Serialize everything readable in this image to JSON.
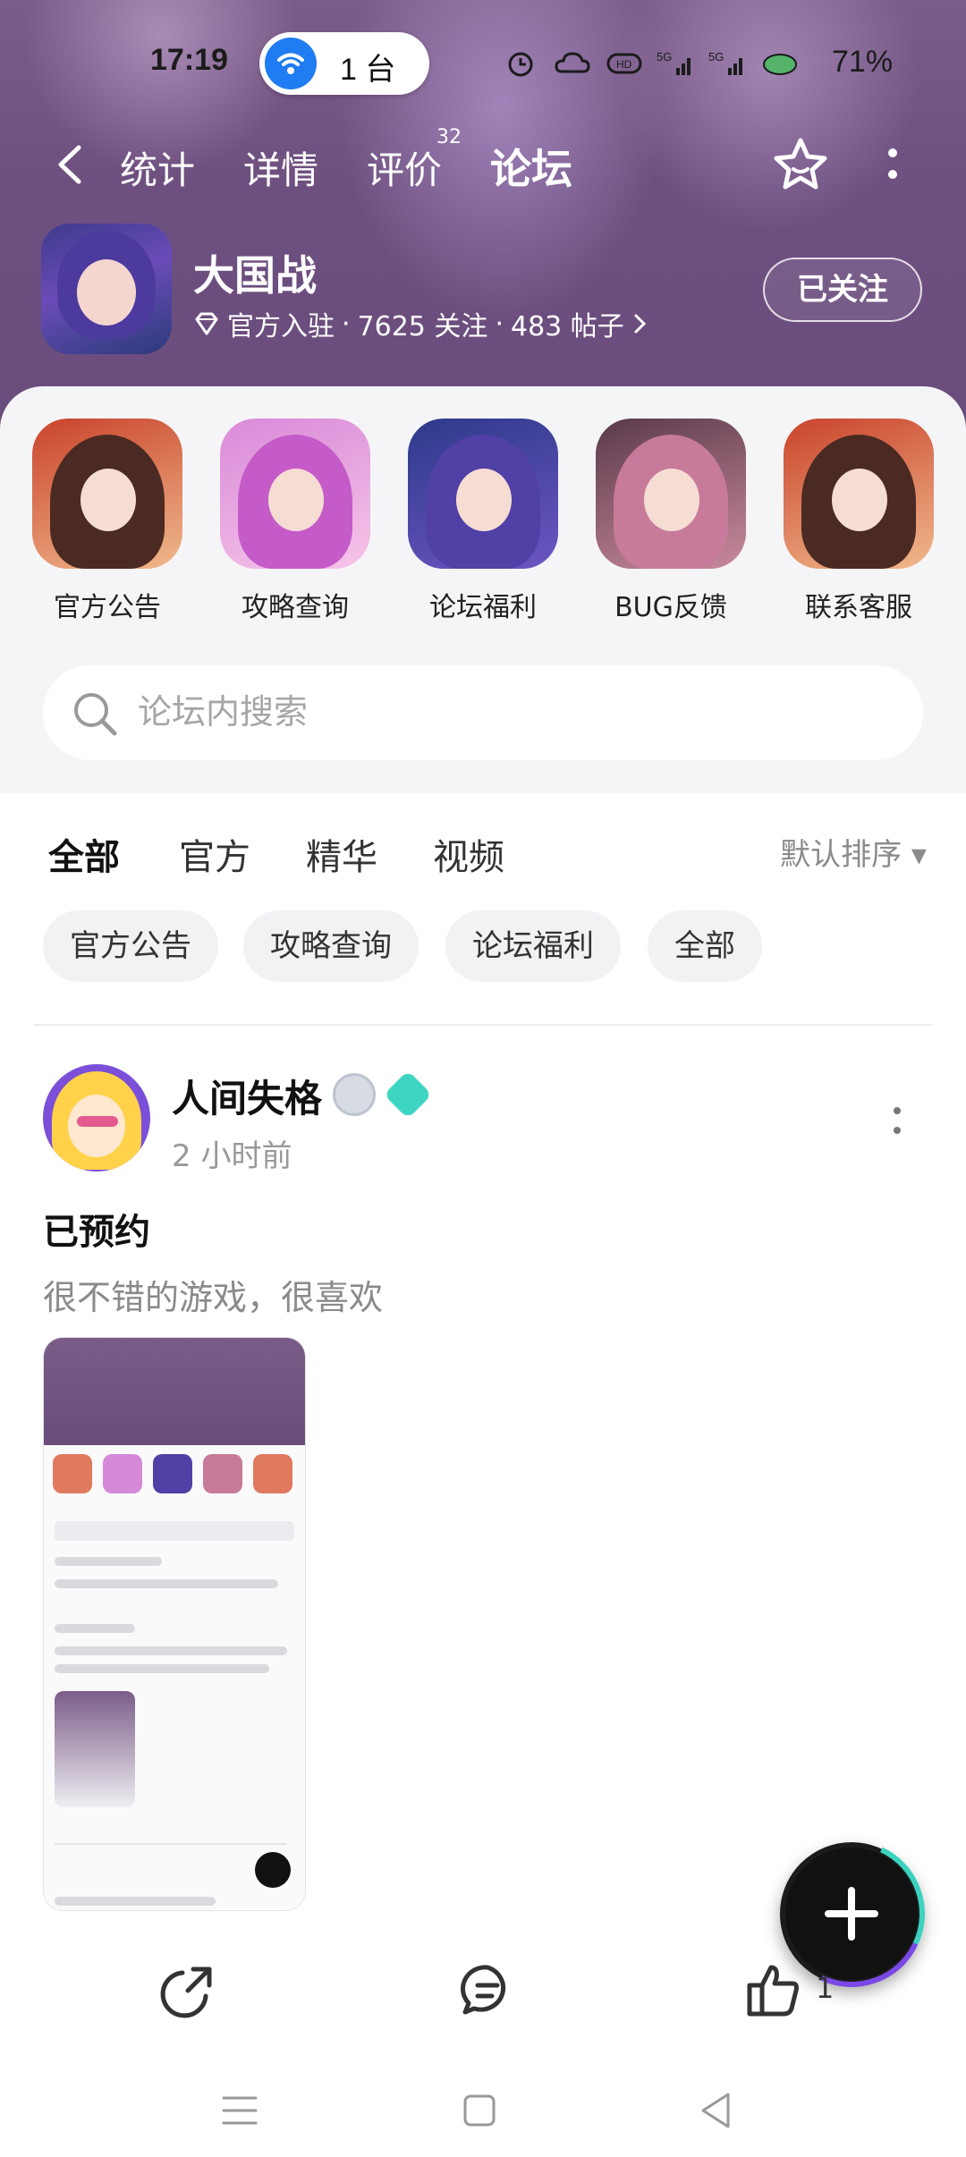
{
  "status_bar": {
    "time": "17:19",
    "hotspot_label": "1 台",
    "battery": "71%"
  },
  "nav": {
    "tabs": [
      {
        "label": "统计"
      },
      {
        "label": "详情"
      },
      {
        "label": "评价",
        "badge": "32"
      },
      {
        "label": "论坛",
        "active": true
      }
    ]
  },
  "game": {
    "title": "大国战",
    "meta_official": "官方入驻",
    "meta_followers": "7625 关注",
    "meta_posts": "483 帖子",
    "follow_label": "已关注"
  },
  "quick_links": [
    {
      "label": "官方公告"
    },
    {
      "label": "攻略查询"
    },
    {
      "label": "论坛福利"
    },
    {
      "label": "BUG反馈"
    },
    {
      "label": "联系客服"
    }
  ],
  "search": {
    "placeholder": "论坛内搜索"
  },
  "filters": {
    "tabs": [
      {
        "label": "全部",
        "active": true
      },
      {
        "label": "官方"
      },
      {
        "label": "精华"
      },
      {
        "label": "视频"
      }
    ],
    "sort_label": "默认排序 ▾",
    "chips": [
      {
        "label": "官方公告"
      },
      {
        "label": "攻略查询"
      },
      {
        "label": "论坛福利"
      },
      {
        "label": "全部"
      }
    ]
  },
  "post": {
    "author": "人间失格",
    "time": "2 小时前",
    "title": "已预约",
    "body": "很不错的游戏，很喜欢"
  },
  "actions": {
    "like_count": "1"
  },
  "colors": {
    "accent": "#2fd0b9",
    "header_bg": "#6e5080",
    "fab_bg": "#111111"
  }
}
